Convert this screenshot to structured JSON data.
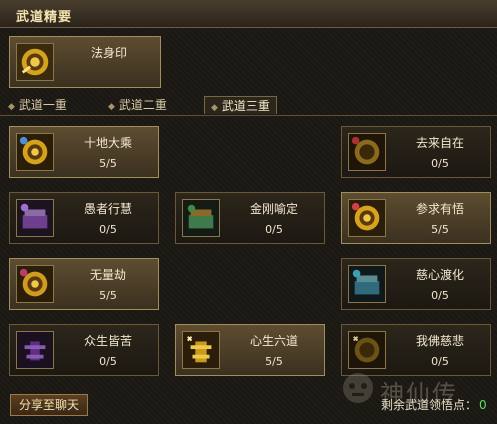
{
  "header": {
    "title": "武道精要"
  },
  "essence": {
    "name": "法身印",
    "icon": "golden-spiral-icon"
  },
  "tabs": [
    {
      "label": "武道一重",
      "active": false
    },
    {
      "label": "武道二重",
      "active": false
    },
    {
      "label": "武道三重",
      "active": true
    }
  ],
  "skills": [
    {
      "name": "十地大乘",
      "count": "5/5",
      "active": true,
      "icon": "golden-spiral-icon",
      "color": "#d4a21b"
    },
    {
      "name": "去来自在",
      "count": "0/5",
      "active": false,
      "icon": "golden-spiral-icon",
      "color": "#8a6a1e"
    },
    {
      "name": "愚者行慧",
      "count": "0/5",
      "active": false,
      "icon": "purple-chest-icon",
      "color": "#6d3f8c"
    },
    {
      "name": "金刚喻定",
      "count": "0/5",
      "active": false,
      "icon": "green-chest-icon",
      "color": "#3f7a4c"
    },
    {
      "name": "参求有悟",
      "count": "5/5",
      "active": true,
      "icon": "golden-spiral-icon",
      "color": "#d9a21e"
    },
    {
      "name": "无量劫",
      "count": "5/5",
      "active": true,
      "icon": "golden-spiral-icon",
      "color": "#d19a20"
    },
    {
      "name": "慈心渡化",
      "count": "0/5",
      "active": false,
      "icon": "blue-chest-icon",
      "color": "#2f6b7a"
    },
    {
      "name": "众生皆苦",
      "count": "0/5",
      "active": false,
      "icon": "purple-pagoda-icon",
      "color": "#5f2f86"
    },
    {
      "name": "心生六道",
      "count": "5/5",
      "active": true,
      "icon": "golden-pagoda-icon",
      "color": "#c99a1e"
    },
    {
      "name": "我佛慈悲",
      "count": "0/5",
      "active": false,
      "icon": "golden-spiral-icon",
      "color": "#6b5216"
    }
  ],
  "footer": {
    "share_label": "分享至聊天",
    "points_label": "剩余武道领悟点：",
    "points_value": "0"
  },
  "watermark": {
    "text": "神仙传"
  }
}
